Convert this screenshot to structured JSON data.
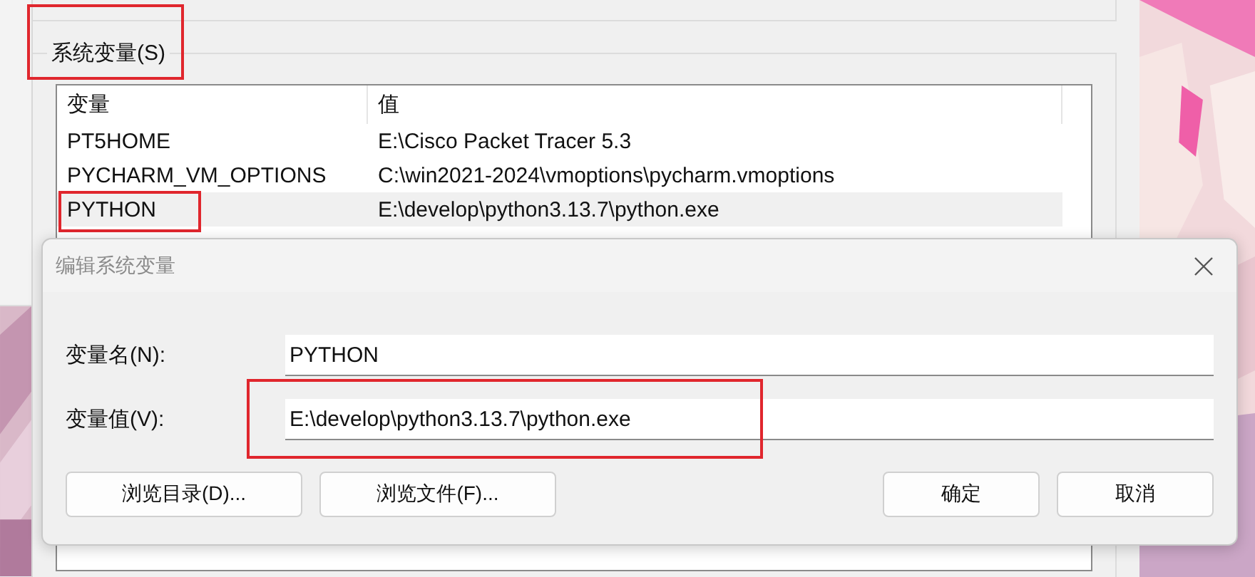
{
  "group": {
    "title": "系统变量(S)",
    "highlighted": true,
    "columns": [
      "变量",
      "值"
    ],
    "rows": [
      {
        "name": "PT5HOME",
        "value": "E:\\Cisco Packet Tracer 5.3",
        "selected": false,
        "highlighted": false
      },
      {
        "name": "PYCHARM_VM_OPTIONS",
        "value": "C:\\win2021-2024\\vmoptions\\pycharm.vmoptions",
        "selected": false,
        "highlighted": false
      },
      {
        "name": "PYTHON",
        "value": "E:\\develop\\python3.13.7\\python.exe",
        "selected": true,
        "highlighted": true
      }
    ]
  },
  "dialog": {
    "title": "编辑系统变量",
    "fields": [
      {
        "label": "变量名(N):",
        "value": "PYTHON",
        "highlighted": false
      },
      {
        "label": "变量值(V):",
        "value": "E:\\develop\\python3.13.7\\python.exe",
        "highlighted": true
      }
    ],
    "browse_buttons": [
      "浏览目录(D)...",
      "浏览文件(F)..."
    ],
    "buttons": [
      "确定",
      "取消"
    ]
  }
}
